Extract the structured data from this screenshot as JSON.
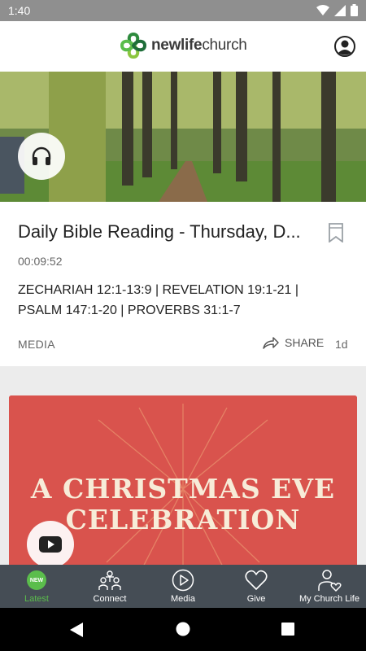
{
  "status_bar": {
    "time": "1:40"
  },
  "header": {
    "brand_bold": "newlife",
    "brand_light": "church"
  },
  "feed": {
    "card1": {
      "title": "Daily Bible Reading - Thursday, D...",
      "duration": "00:09:52",
      "passage": "ZECHARIAH 12:1-13:9 | REVELATION 19:1-21 | PSALM 147:1-20 | PROVERBS 31:1-7",
      "category": "MEDIA",
      "share_label": "SHARE",
      "age": "1d"
    },
    "card2": {
      "line1": "A CHRISTMAS EVE",
      "line2": "CELEBRATION"
    }
  },
  "bottom_nav": {
    "badge": "NEW",
    "items": [
      {
        "label": "Latest"
      },
      {
        "label": "Connect"
      },
      {
        "label": "Media"
      },
      {
        "label": "Give"
      },
      {
        "label": "My Church Life"
      }
    ]
  },
  "colors": {
    "accent": "#5bbd4c",
    "nav_bg": "#454d55",
    "card2_bg": "#d9534d"
  }
}
